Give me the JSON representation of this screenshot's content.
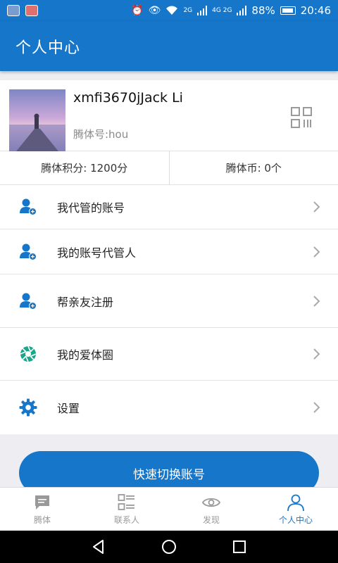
{
  "status_bar": {
    "battery": "88%",
    "time": "20:46",
    "network_labels": [
      "2G",
      "4G 2G"
    ]
  },
  "header": {
    "title": "个人中心"
  },
  "profile": {
    "username": "xmfi3670jJack Li",
    "tengti_id": "腾体号:hou"
  },
  "points": {
    "score": "腾体积分: 1200分",
    "coins": "腾体币: 0个"
  },
  "menu": {
    "items": [
      {
        "label": "我代管的账号",
        "icon": "person-add-icon"
      },
      {
        "label": "我的账号代管人",
        "icon": "person-add-icon"
      },
      {
        "label": "帮亲友注册",
        "icon": "person-add-icon"
      },
      {
        "label": "我的爱体圈",
        "icon": "aperture-icon"
      },
      {
        "label": "设置",
        "icon": "gear-icon"
      }
    ]
  },
  "actions": {
    "quick_switch": "快速切换账号"
  },
  "bottom_nav": {
    "items": [
      {
        "label": "腾体",
        "icon": "chat-icon",
        "active": false
      },
      {
        "label": "联系人",
        "icon": "contacts-icon",
        "active": false
      },
      {
        "label": "发现",
        "icon": "eye-icon",
        "active": false
      },
      {
        "label": "个人中心",
        "icon": "person-icon",
        "active": true
      }
    ]
  },
  "colors": {
    "primary": "#1676c9",
    "accent_teal": "#1aa68a",
    "background": "#eeeef2"
  }
}
